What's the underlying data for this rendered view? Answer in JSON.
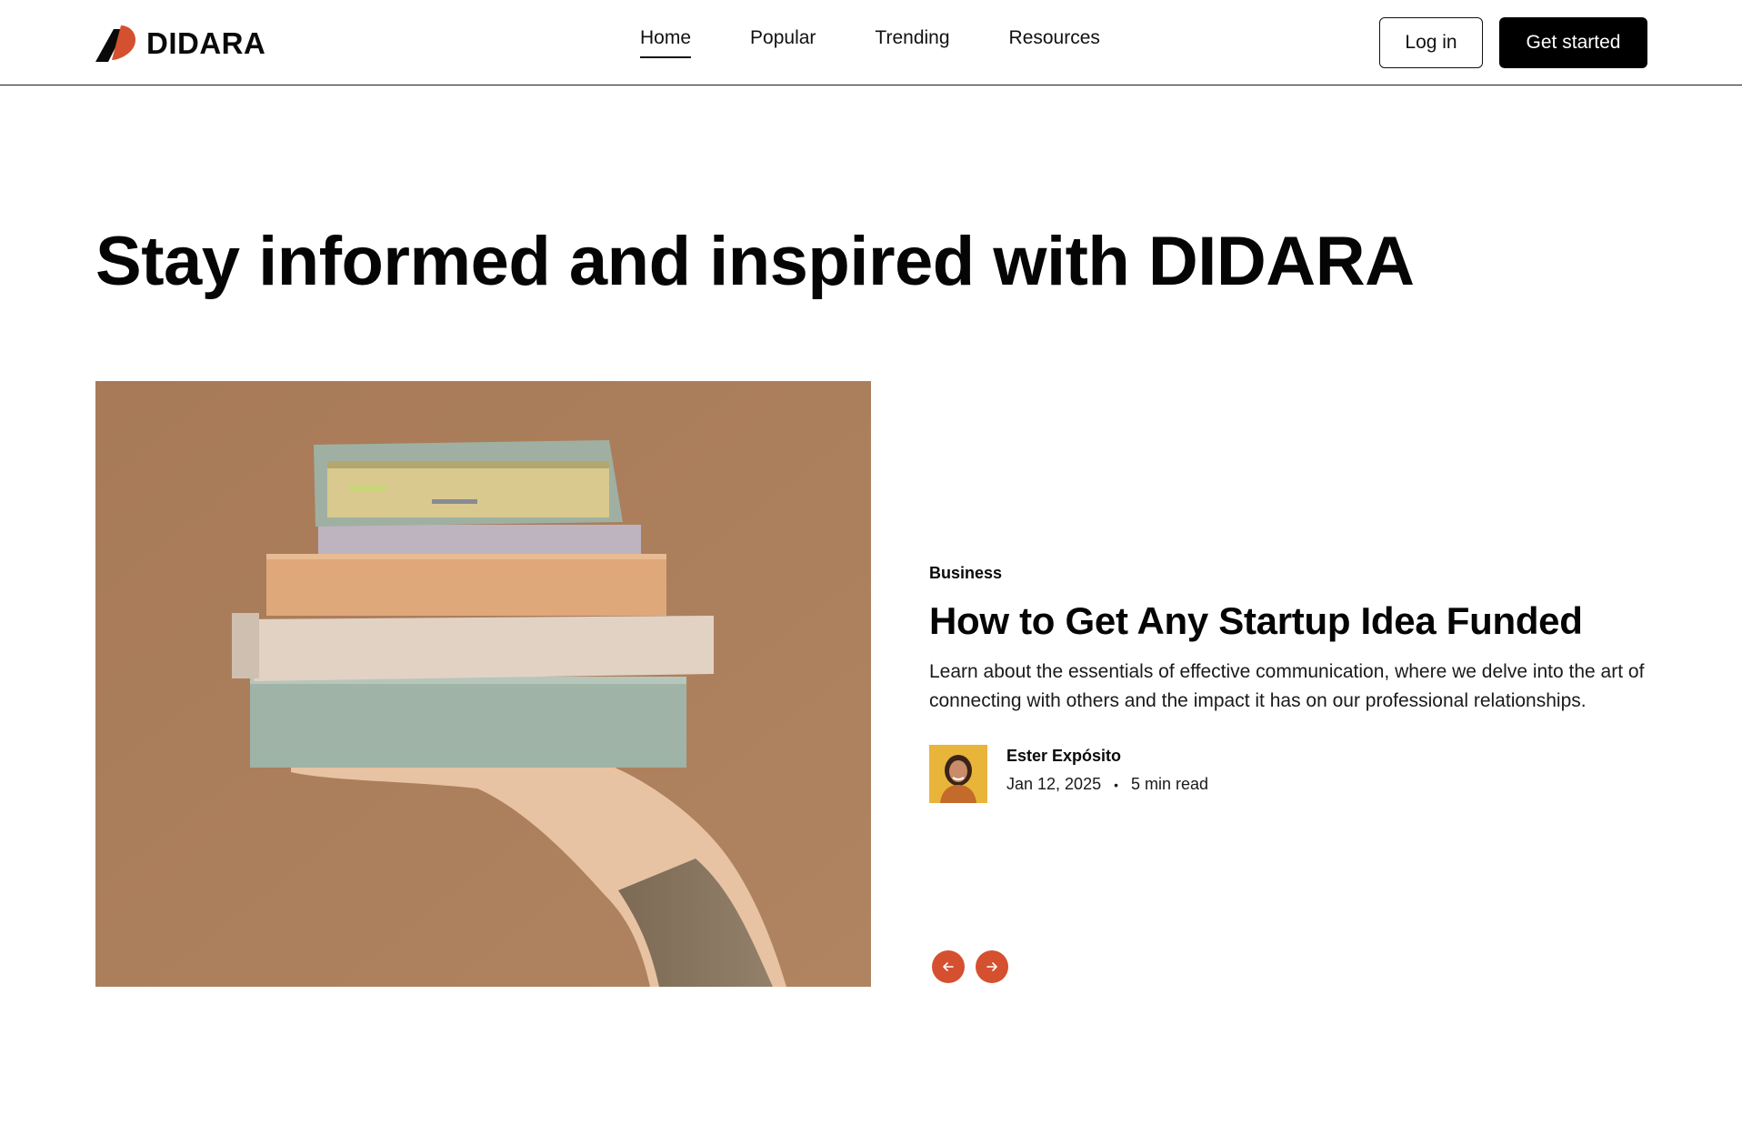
{
  "brand": {
    "name": "DIDARA",
    "accent_color": "#d4502f"
  },
  "nav": {
    "items": [
      {
        "label": "Home",
        "active": true
      },
      {
        "label": "Popular",
        "active": false
      },
      {
        "label": "Trending",
        "active": false
      },
      {
        "label": "Resources",
        "active": false
      }
    ],
    "login_label": "Log in",
    "cta_label": "Get started"
  },
  "hero": {
    "title": "Stay informed and inspired with DIDARA"
  },
  "featured": {
    "image_icon": "stacked-books-photo",
    "category": "Business",
    "title": "How to Get Any Startup Idea Funded",
    "description": "Learn about the essentials of effective communication, where we delve into the art of connecting with others and the impact it has on our professional relationships.",
    "author": {
      "name": "Ester Expósito",
      "avatar_icon": "author-avatar"
    },
    "date": "Jan 12, 2025",
    "separator": "•",
    "read_time": "5 min read"
  },
  "carousel": {
    "prev_icon": "arrow-left-icon",
    "next_icon": "arrow-right-icon"
  }
}
